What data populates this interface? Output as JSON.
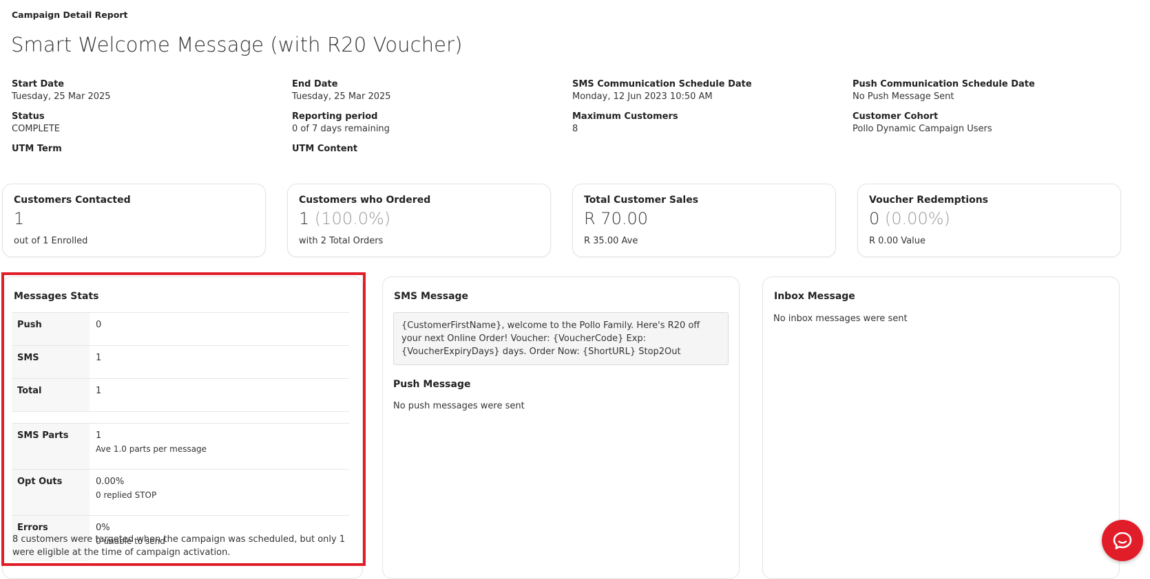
{
  "header": {
    "breadcrumb": "Campaign Detail Report",
    "title": "Smart Welcome Message (with R20 Voucher)"
  },
  "meta": {
    "start_date": {
      "label": "Start Date",
      "value": "Tuesday, 25 Mar 2025"
    },
    "status": {
      "label": "Status",
      "value": "COMPLETE"
    },
    "utm_term": {
      "label": "UTM Term",
      "value": ""
    },
    "end_date": {
      "label": "End Date",
      "value": "Tuesday, 25 Mar 2025"
    },
    "reporting_period": {
      "label": "Reporting period",
      "value": "0 of 7 days remaining"
    },
    "utm_content": {
      "label": "UTM Content",
      "value": ""
    },
    "sms_schedule": {
      "label": "SMS Communication Schedule Date",
      "value": "Monday, 12 Jun 2023 10:50 AM"
    },
    "max_customers": {
      "label": "Maximum Customers",
      "value": "8"
    },
    "push_schedule": {
      "label": "Push Communication Schedule Date",
      "value": "No Push Message Sent"
    },
    "cohort": {
      "label": "Customer Cohort",
      "value": "Pollo Dynamic Campaign Users"
    }
  },
  "kpis": [
    {
      "label": "Customers Contacted",
      "value": "1",
      "pct": "",
      "sub": "out of 1 Enrolled"
    },
    {
      "label": "Customers who Ordered",
      "value": "1",
      "pct": "(100.0%)",
      "sub": "with 2 Total Orders"
    },
    {
      "label": "Total Customer Sales",
      "value": "R 70.00",
      "pct": "",
      "sub": "R 35.00 Ave"
    },
    {
      "label": "Voucher Redemptions",
      "value": "0",
      "pct": "(0.00%)",
      "sub": "R 0.00 Value"
    }
  ],
  "messages_stats": {
    "title": "Messages Stats",
    "push": {
      "label": "Push",
      "value": "0"
    },
    "sms": {
      "label": "SMS",
      "value": "1"
    },
    "total": {
      "label": "Total",
      "value": "1"
    },
    "sms_parts": {
      "label": "SMS Parts",
      "value": "1",
      "sub": "Ave 1.0 parts per message"
    },
    "opt_outs": {
      "label": "Opt Outs",
      "value": "0.00%",
      "sub": "0 replied STOP"
    },
    "errors": {
      "label": "Errors",
      "value": "0%",
      "sub": "0 unable to send"
    },
    "note": "8 customers were targeted when the campaign was scheduled, but only 1 were eligible at the time of campaign activation."
  },
  "sms_message": {
    "title": "SMS Message",
    "body": "{CustomerFirstName}, welcome to the Pollo Family. Here's R20 off your next Online Order! Voucher: {VoucherCode} Exp: {VoucherExpiryDays} days. Order Now: {ShortURL} Stop2Out"
  },
  "push_message": {
    "title": "Push Message",
    "body": "No push messages were sent"
  },
  "inbox_message": {
    "title": "Inbox Message",
    "body": "No inbox messages were sent"
  },
  "colors": {
    "highlight": "#e11d2a",
    "chat_button": "#e11d2a"
  },
  "icons": {
    "chat": "chat-bubble-icon"
  }
}
